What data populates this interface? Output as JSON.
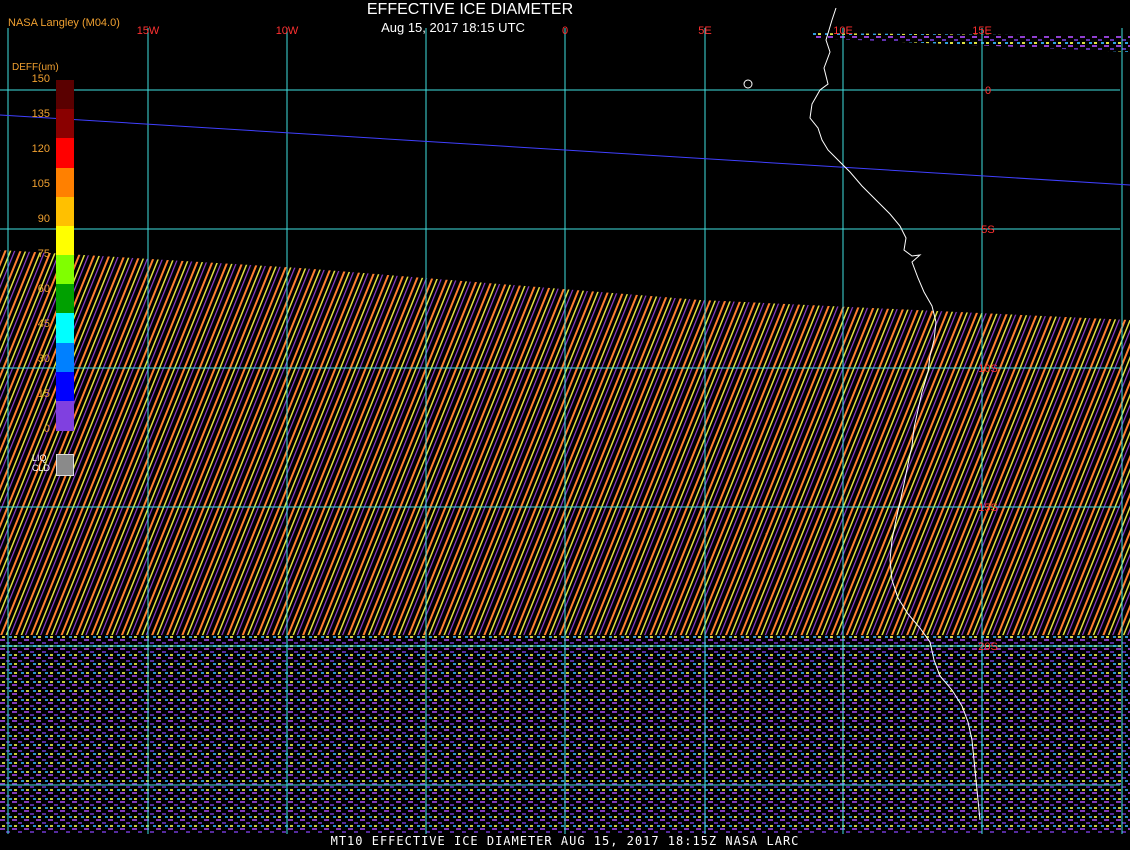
{
  "header": {
    "title": "EFFECTIVE ICE DIAMETER",
    "subtitle": "Aug 15, 2017 18:15 UTC",
    "producer": "NASA Langley (M04.0)"
  },
  "footer": {
    "caption": "MT10  EFFECTIVE ICE DIAMETER  AUG 15, 2017 18:15Z  NASA LARC"
  },
  "colorbar": {
    "title": "DEFF(um)",
    "ticks": [
      "150",
      "135",
      "120",
      "105",
      "90",
      "75",
      "60",
      "45",
      "30",
      "15",
      "0"
    ],
    "colors": [
      "#5a0000",
      "#8a0000",
      "#ff0000",
      "#ff8000",
      "#ffc000",
      "#ffff00",
      "#80ff00",
      "#00a000",
      "#00ffff",
      "#0080ff",
      "#0000ff",
      "#8040e0"
    ],
    "liquid_label_line1": "LIQ",
    "liquid_label_line2": "CLD",
    "liquid_color": "#8a8a8a"
  },
  "map": {
    "longitude_labels": [
      {
        "text": "15W"
      },
      {
        "text": "10W"
      },
      {
        "text": "0"
      },
      {
        "text": "5E"
      },
      {
        "text": "10E"
      },
      {
        "text": "15E"
      }
    ],
    "latitude_labels": [
      {
        "text": "0"
      },
      {
        "text": "5S"
      },
      {
        "text": "10S"
      },
      {
        "text": "15S"
      },
      {
        "text": "20S"
      }
    ],
    "grid_color": "#40e0e0",
    "label_color": "#ff3030",
    "coast_color": "#ffffff",
    "track_color": "#4040ff",
    "stripe_colors": [
      "#ff8030",
      "#e0e040",
      "#9040d0"
    ]
  }
}
